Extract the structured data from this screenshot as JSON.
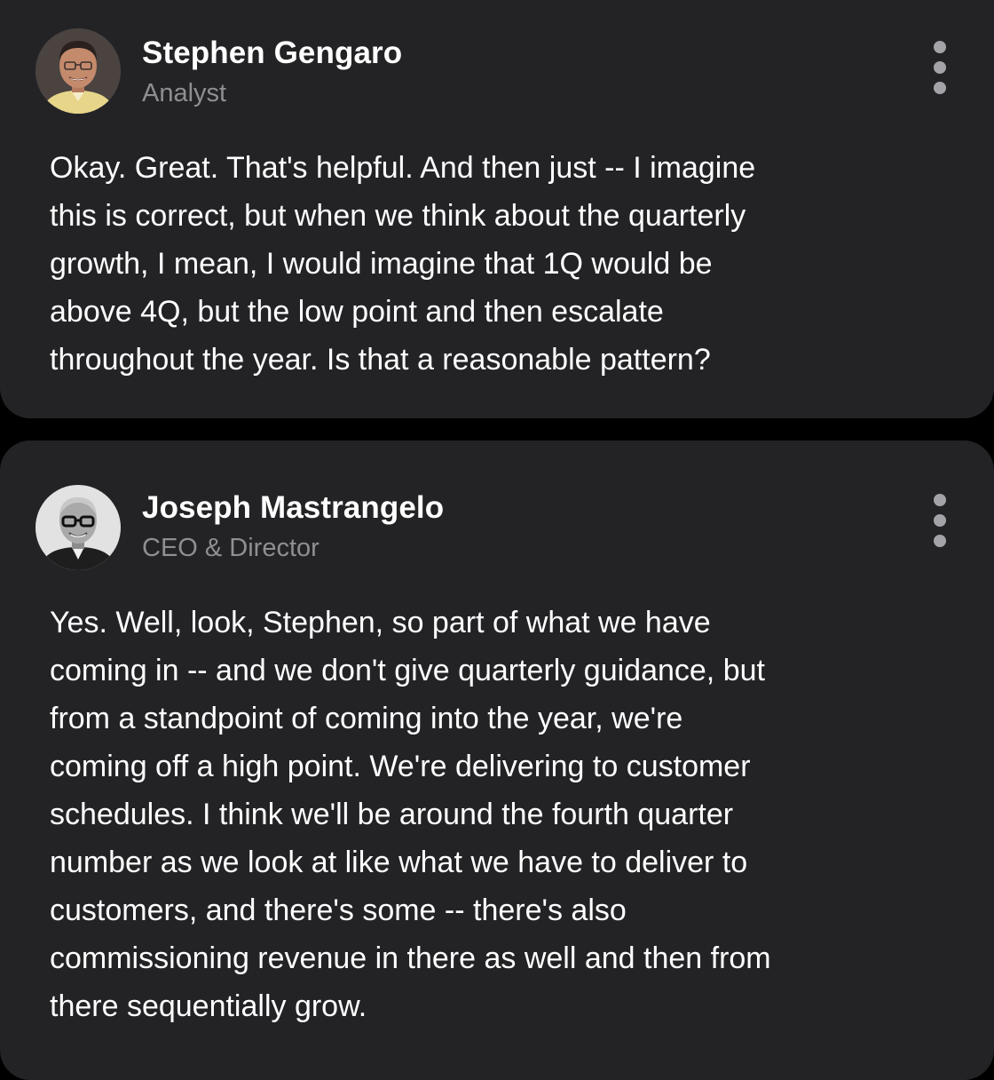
{
  "posts": [
    {
      "author_name": "Stephen Gengaro",
      "author_role": "Analyst",
      "avatar_icon": "person-photo-icon",
      "menu_icon": "more-vertical-icon",
      "body": "Okay. Great. That's helpful. And then just -- I imagine\nthis is correct, but when we think about the quarterly\ngrowth, I mean, I would imagine that 1Q would be\nabove 4Q, but the low point and then escalate\nthroughout the year. Is that a reasonable pattern?"
    },
    {
      "author_name": "Joseph Mastrangelo",
      "author_role": "CEO & Director",
      "avatar_icon": "person-photo-icon",
      "menu_icon": "more-vertical-icon",
      "body": "Yes. Well, look, Stephen, so part of what we have\ncoming in -- and we don't give quarterly guidance, but\nfrom a standpoint of coming into the year, we're\ncoming off a high point. We're delivering to customer\nschedules. I think we'll be around the fourth quarter\nnumber as we look at like what we have to deliver to\ncustomers, and there's some -- there's also\ncommissioning revenue in there as well and then from\nthere sequentially grow."
    }
  ],
  "colors": {
    "background": "#000000",
    "card": "#232326",
    "text": "#ffffff",
    "secondary_text": "#8e8e93",
    "menu_dots": "#a3a3a8"
  }
}
